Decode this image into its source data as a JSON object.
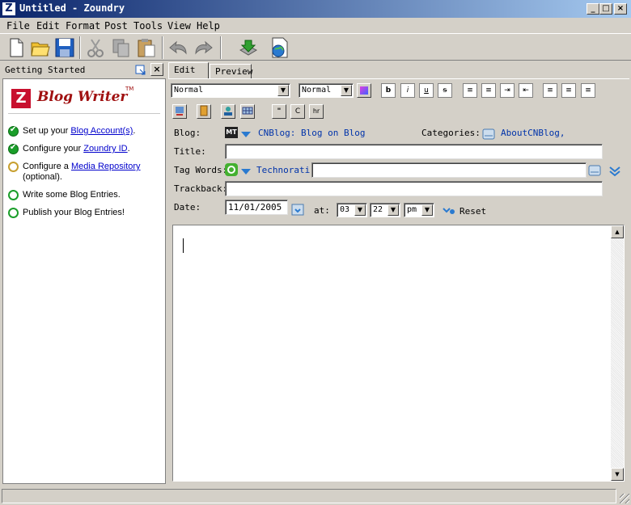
{
  "window": {
    "title": "Untitled - Zoundry",
    "logo_letter": "Z"
  },
  "menu": [
    "File",
    "Edit",
    "Format",
    "Post",
    "Tools",
    "View",
    "Help"
  ],
  "toolbar_icons": [
    "new-document-icon",
    "open-folder-icon",
    "save-disk-icon",
    "cut-icon",
    "copy-icon",
    "paste-icon",
    "undo-icon",
    "redo-icon",
    "publish-icon",
    "preview-web-icon"
  ],
  "left_panel": {
    "title": "Getting Started",
    "logo": {
      "letter": "Z",
      "text": "Blog Writer",
      "tm": "TM"
    },
    "tasks": [
      {
        "status": "done",
        "prefix": "Set up your ",
        "link": "Blog Account(s)",
        "suffix": "."
      },
      {
        "status": "done",
        "prefix": "Configure your ",
        "link": "Zoundry ID",
        "suffix": "."
      },
      {
        "status": "optional",
        "prefix": "Configure a ",
        "link": "Media Repository",
        "suffix": " (optional)."
      },
      {
        "status": "todo",
        "prefix": "Write some Blog Entries.",
        "link": "",
        "suffix": ""
      },
      {
        "status": "todo",
        "prefix": "Publish your Blog Entries!",
        "link": "",
        "suffix": ""
      }
    ]
  },
  "tabs": {
    "edit": "Edit",
    "preview": "Preview"
  },
  "format": {
    "paragraph_style": "Normal",
    "font_size": "Normal",
    "buttons": [
      "b",
      "i",
      "u",
      "s"
    ],
    "insert_buttons": [
      "\"",
      "C",
      "hr"
    ]
  },
  "post": {
    "blog_label": "Blog:",
    "blog_badge": "MT",
    "blog_value": "CNBlog: Blog on Blog",
    "categories_label": "Categories:",
    "categories_value": "AboutCNBlog,",
    "title_label": "Title:",
    "title_value": "",
    "tagwords_label": "Tag Words:",
    "tag_service": "Technorati",
    "tagwords_value": "",
    "trackback_label": "Trackback:",
    "trackback_value": "",
    "date_label": "Date:",
    "date_value": "11/01/2005",
    "at_label": "at:",
    "hour": "03",
    "minute": "22",
    "ampm": "pm",
    "reset_label": "Reset"
  },
  "colors": {
    "title_gradient_start": "#0a246a",
    "title_gradient_end": "#a6caf0",
    "link": "#0033aa",
    "brand_red": "#c8102e",
    "check_green": "#1a9e2a"
  }
}
